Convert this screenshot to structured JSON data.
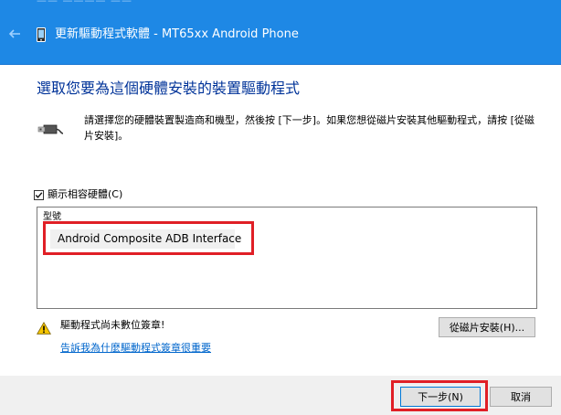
{
  "window": {
    "title": "更新驅動程式軟體 - MT65xx Android Phone",
    "top_strip_text": "—— ———— ——"
  },
  "page": {
    "heading": "選取您要為這個硬體安裝的裝置驅動程式",
    "description": "請選擇您的硬體裝置製造商和機型，然後按 [下一步]。如果您想從磁片安裝其他驅動程式，請按 [從磁片安裝]。"
  },
  "compatible_checkbox": {
    "label": "顯示相容硬體(C)",
    "checked": true
  },
  "model_list": {
    "header": "型號",
    "items": [
      "Android Composite ADB Interface"
    ]
  },
  "warning": {
    "text": "驅動程式尚未數位簽章!",
    "link": "告訴我為什麼驅動程式簽章很重要"
  },
  "buttons": {
    "have_disk": "從磁片安裝(H)...",
    "next": "下一步(N)",
    "cancel": "取消"
  },
  "colors": {
    "titlebar": "#1e88e5",
    "heading": "#003399",
    "highlight": "#e01f26",
    "link": "#0066cc"
  }
}
